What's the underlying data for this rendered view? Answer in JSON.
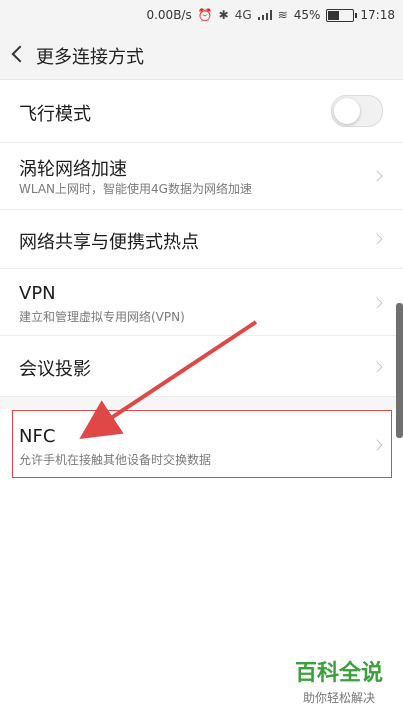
{
  "statusbar": {
    "speed": "0.00B/s",
    "network_label": "4G",
    "battery_percent": "45%",
    "battery_level": 0.45,
    "time": "17:18",
    "icons": [
      "alarm-icon",
      "bluetooth-icon",
      "signal-icon",
      "wifi-icon",
      "battery-icon"
    ]
  },
  "header": {
    "title": "更多连接方式"
  },
  "items": [
    {
      "main": "飞行模式",
      "toggle_on": false
    },
    {
      "main": "涡轮网络加速",
      "sub": "WLAN上网时，智能使用4G数据为网络加速"
    },
    {
      "main": "网络共享与便携式热点"
    },
    {
      "main": "VPN",
      "sub": "建立和管理虚拟专用网络(VPN)"
    },
    {
      "main": "会议投影"
    },
    {
      "main": "NFC",
      "sub": "允许手机在接触其他设备时交换数据"
    }
  ],
  "annotation": {
    "highlight_color": "#e04848"
  },
  "watermark": {
    "big": "百科全说",
    "small": "助你轻松解决"
  }
}
